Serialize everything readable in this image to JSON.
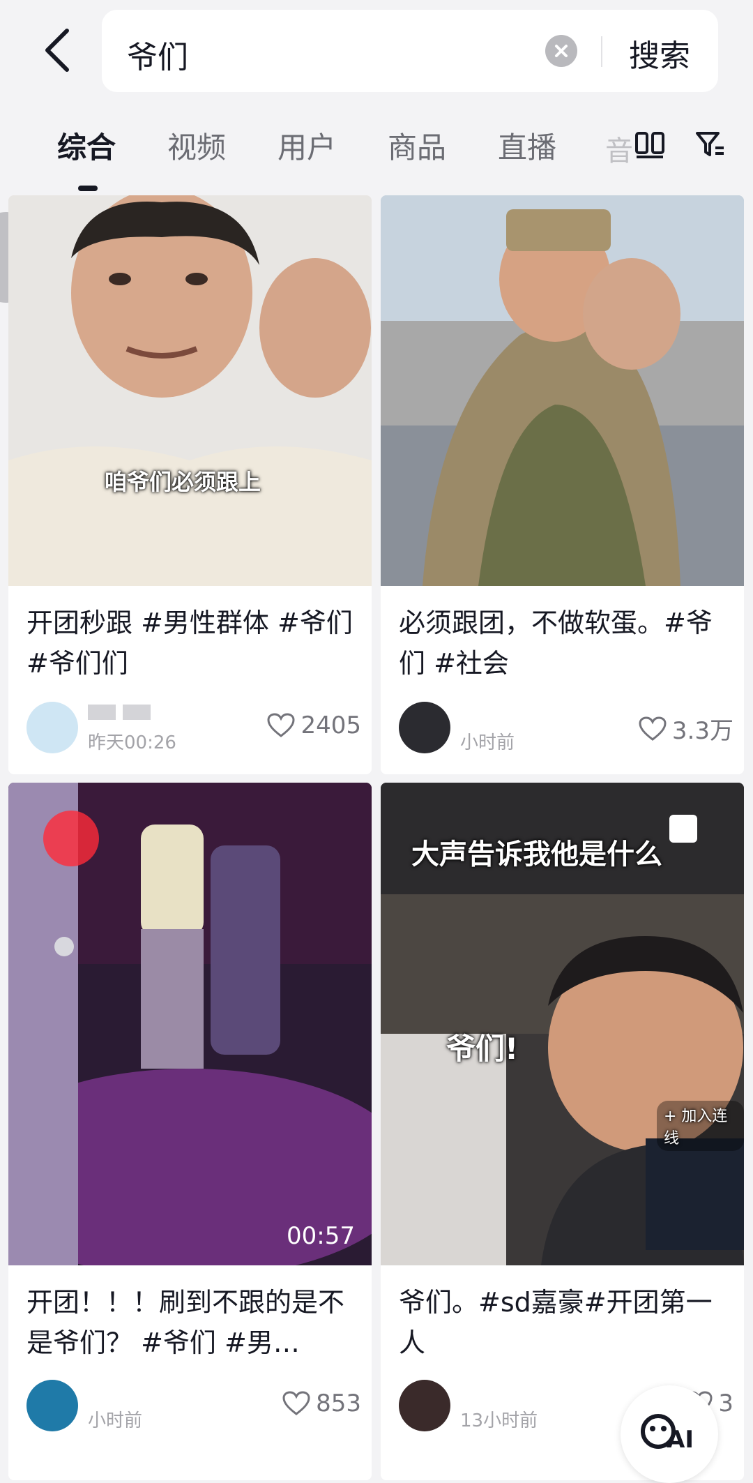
{
  "search": {
    "query": "爷们",
    "button_label": "搜索"
  },
  "tabs": [
    {
      "label": "综合"
    },
    {
      "label": "视频"
    },
    {
      "label": "用户"
    },
    {
      "label": "商品"
    },
    {
      "label": "直播"
    },
    {
      "label": "音"
    }
  ],
  "results": [
    {
      "caption_overlay": "咱爷们必须跟上",
      "title": "开团秒跟 #男性群体 #爷们 #爷们们",
      "time": "昨天00:26",
      "likes": "2405",
      "icon": "heart-icon"
    },
    {
      "title": "必须跟团，不做软蛋。#爷们 #社会",
      "time": "小时前",
      "likes": "3.3万",
      "icon": "heart-icon"
    },
    {
      "duration": "00:57",
      "title": "开团！！！刷到不跟的是不是爷们？ #爷们 #男…",
      "time": "小时前",
      "likes": "853",
      "icon": "heart-icon"
    },
    {
      "caption_top": "大声告诉我他是什么",
      "caption_mid": "爷们!",
      "live_hint": "+ 加入连线",
      "title": "爷们。#sd嘉豪#开团第一人",
      "time": "13小时前",
      "likes": "3",
      "icon": "heart-icon"
    }
  ],
  "ai_button": {
    "label": "AI"
  },
  "colors": {
    "background": "#f3f3f5",
    "text": "#161823",
    "muted": "#a3a3a8"
  }
}
